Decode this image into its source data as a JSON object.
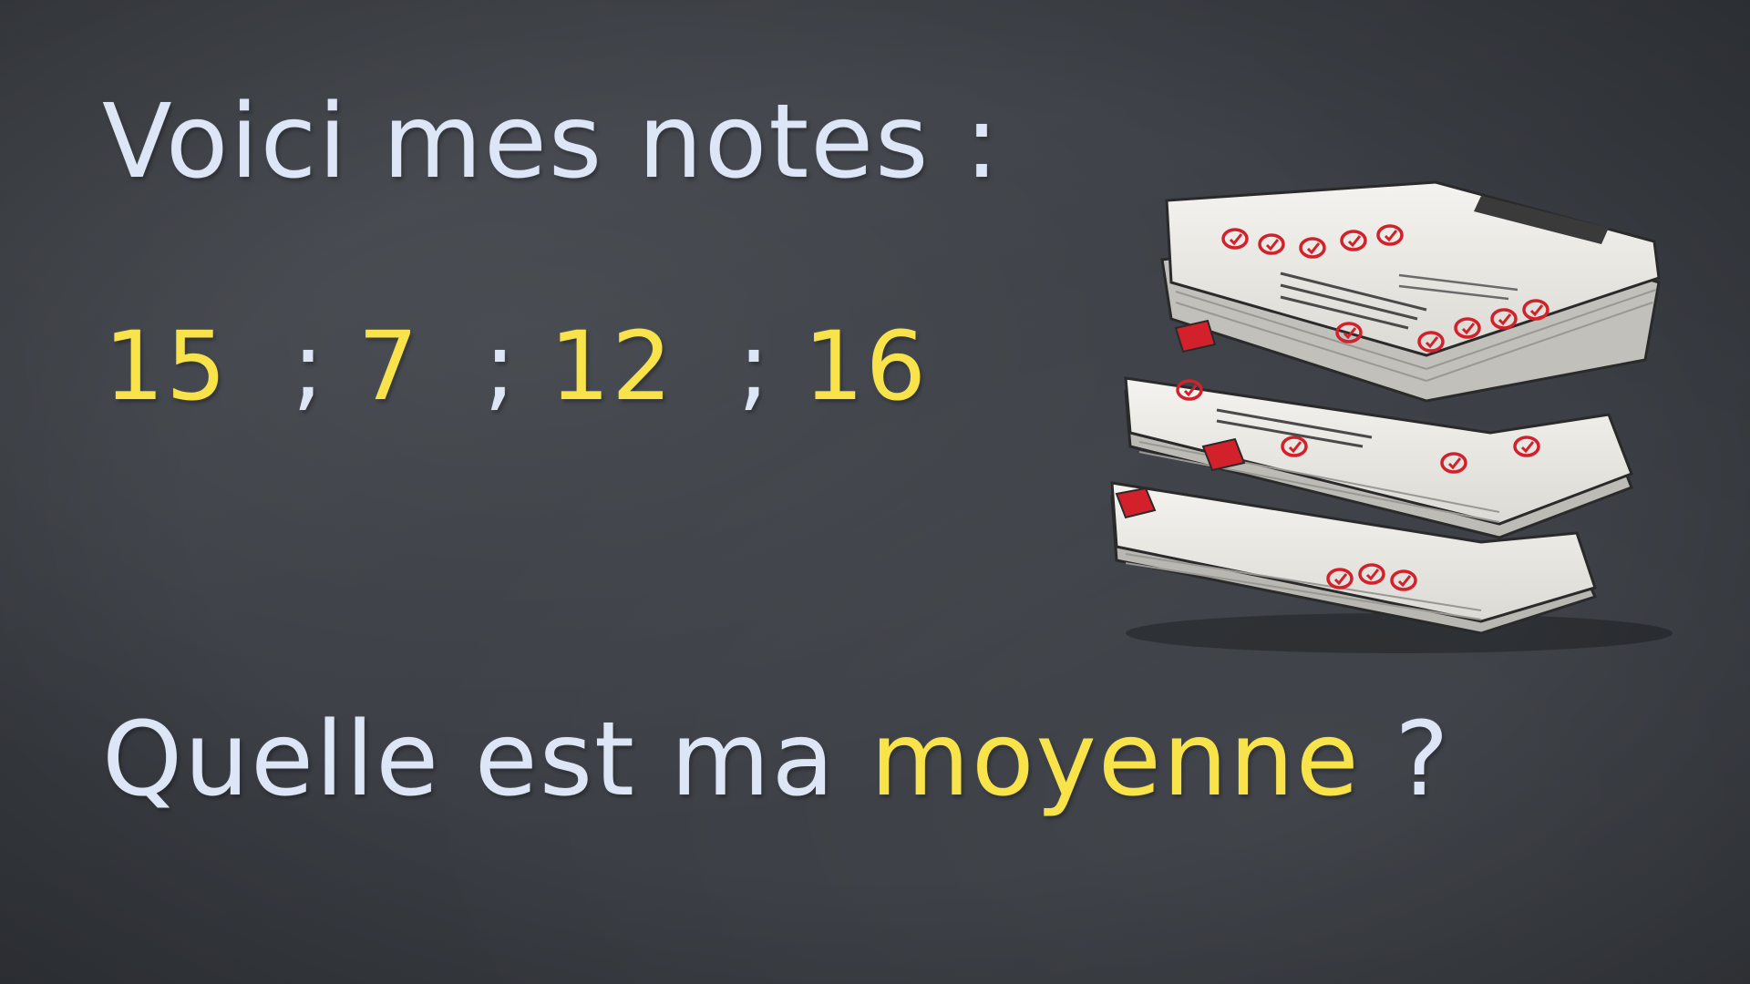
{
  "line1": "Voici mes notes :",
  "grades": {
    "g1": "15",
    "g2": "7",
    "g3": "12",
    "g4": "16",
    "separator": ";"
  },
  "question": {
    "prefix": "Quelle est ma ",
    "highlight": "moyenne",
    "suffix": " ?"
  },
  "colors": {
    "board": "#3d4147",
    "chalk_white": "#dde6f6",
    "chalk_yellow": "#f9e34a",
    "paper": "#eeece6",
    "mark_red": "#d3212b"
  },
  "illustration": "stack-of-graded-papers-icon"
}
